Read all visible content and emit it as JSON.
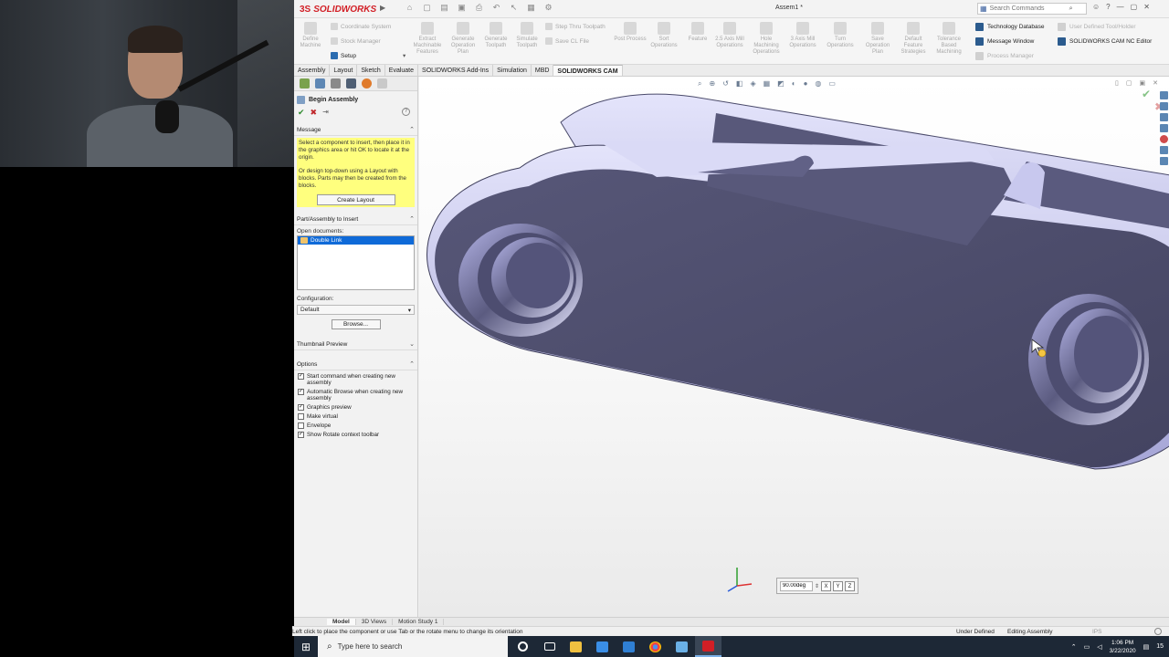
{
  "app": {
    "brand_prefix": "3S",
    "brand_name": "SOLIDWORKS",
    "document_title": "Assem1 *",
    "search_placeholder": "Search Commands"
  },
  "command_manager": {
    "large_buttons": [
      {
        "label": "Define Machine",
        "icon": "machine-icon"
      },
      {
        "label": "Extract Machinable Features",
        "icon": "extract-features-icon"
      },
      {
        "label": "Generate Operation Plan",
        "icon": "operation-plan-icon"
      },
      {
        "label": "Generate Toolpath",
        "icon": "toolpath-icon"
      },
      {
        "label": "Simulate Toolpath",
        "icon": "simulate-icon"
      },
      {
        "label": "Post Process",
        "icon": "post-process-icon"
      },
      {
        "label": "Sort Operations",
        "icon": "sort-icon"
      },
      {
        "label": "Feature",
        "icon": "feature-icon"
      },
      {
        "label": "2.5 Axis Mill Operations",
        "icon": "mill-25-icon"
      },
      {
        "label": "Hole Machining Operations",
        "icon": "hole-machining-icon"
      },
      {
        "label": "3 Axis Mill Operations",
        "icon": "mill-3-icon"
      },
      {
        "label": "Turn Operations",
        "icon": "turn-icon"
      },
      {
        "label": "Save Operation Plan",
        "icon": "save-plan-icon"
      },
      {
        "label": "Default Feature Strategies",
        "icon": "strategies-icon"
      },
      {
        "label": "Tolerance Based Machining",
        "icon": "tolerance-icon"
      }
    ],
    "small_buttons": {
      "coordinate_system": "Coordinate System",
      "stock_manager": "Stock Manager",
      "setup": "Setup",
      "step_thru_toolpath": "Step Thru Toolpath",
      "save_cl_file": "Save CL File"
    },
    "right_buttons": {
      "technology_database": "Technology Database",
      "message_window": "Message Window",
      "process_manager": "Process Manager",
      "user_defined_tool": "User Defined Tool/Holder",
      "cam_nc_editor": "SOLIDWORKS CAM NC Editor"
    }
  },
  "tabs": [
    "Assembly",
    "Layout",
    "Sketch",
    "Evaluate",
    "SOLIDWORKS Add-Ins",
    "Simulation",
    "MBD",
    "SOLIDWORKS CAM"
  ],
  "active_tab": "SOLIDWORKS CAM",
  "property_manager": {
    "title": "Begin Assembly",
    "message_header": "Message",
    "message_1": "Select a component to insert, then place it in the graphics area or hit OK to locate it at the origin.",
    "message_2": "Or design top-down using a Layout with blocks. Parts may then be created from the blocks.",
    "create_layout": "Create Layout",
    "insert_header": "Part/Assembly to Insert",
    "open_documents_label": "Open documents:",
    "open_documents": [
      "Double Link"
    ],
    "configuration_label": "Configuration:",
    "configuration_value": "Default",
    "browse": "Browse...",
    "thumbnail_header": "Thumbnail Preview",
    "options_header": "Options",
    "options": [
      {
        "label": "Start command when creating new assembly",
        "checked": true
      },
      {
        "label": "Automatic Browse when creating new assembly",
        "checked": true
      },
      {
        "label": "Graphics preview",
        "checked": true
      },
      {
        "label": "Make virtual",
        "checked": false
      },
      {
        "label": "Envelope",
        "checked": false
      },
      {
        "label": "Show Rotate context toolbar",
        "checked": true
      }
    ]
  },
  "graphics": {
    "rotate_value": "90.00deg",
    "triad_labels": {
      "x": "X",
      "y": "Y",
      "z": "Z"
    }
  },
  "bottom_tabs": [
    "Model",
    "3D Views",
    "Motion Study 1"
  ],
  "status": {
    "message": "Left click to place the component or use Tab or the rotate menu to change its orientation",
    "definition": "Under Defined",
    "mode": "Editing Assembly",
    "units": "IPS"
  },
  "taskbar": {
    "search_placeholder": "Type here to search",
    "time": "1:06 PM",
    "date": "3/22/2020",
    "notification_count": "15"
  },
  "colors": {
    "accent_red": "#d21f26",
    "selection_blue": "#0f6ad8",
    "message_yellow": "#ffff7e",
    "part_face": "#4c4c6c",
    "part_highlight": "#c9c9ee",
    "taskbar_bg": "#1d2836"
  }
}
